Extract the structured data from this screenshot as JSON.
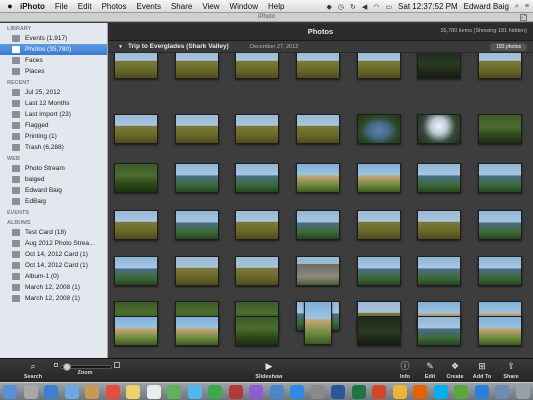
{
  "menubar": {
    "app": "iPhoto",
    "items": [
      "File",
      "Edit",
      "Photos",
      "Events",
      "Share",
      "View",
      "Window",
      "Help"
    ],
    "clock": "Sat 12:37:52 PM",
    "user": "Edward Baig",
    "icons": [
      "apple-icon",
      "dropbox-icon",
      "time-machine-icon",
      "sync-icon",
      "volume-icon",
      "wifi-icon",
      "battery-icon",
      "spotlight-icon",
      "list-icon"
    ]
  },
  "window": {
    "title": "iPhoto"
  },
  "sidebar": {
    "library_heading": "LIBRARY",
    "library": [
      {
        "label": "Events (1,917)",
        "icon": "events-icon"
      },
      {
        "label": "Photos (35,780)",
        "icon": "photos-icon",
        "selected": true
      },
      {
        "label": "Faces",
        "icon": "faces-icon"
      },
      {
        "label": "Places",
        "icon": "places-icon"
      }
    ],
    "recent_heading": "RECENT",
    "recent": [
      {
        "label": "Jul 25, 2012",
        "icon": "event-icon"
      },
      {
        "label": "Last 12 Months",
        "icon": "calendar-icon"
      },
      {
        "label": "Last Import (23)",
        "icon": "import-icon"
      },
      {
        "label": "Flagged",
        "icon": "flag-icon"
      },
      {
        "label": "Printing (1)",
        "icon": "print-icon"
      },
      {
        "label": "Trash (6,288)",
        "icon": "trash-icon"
      }
    ],
    "web_heading": "WEB",
    "web": [
      {
        "label": "Photo Stream",
        "icon": "photo-stream-icon"
      },
      {
        "label": "baiged",
        "icon": "web-album-icon"
      },
      {
        "label": "Edward Baig",
        "icon": "web-album-icon"
      },
      {
        "label": "EdBaig",
        "icon": "web-album-icon"
      }
    ],
    "events_heading": "EVENTS",
    "albums_heading": "ALBUMS",
    "albums": [
      {
        "label": "Test Card (18)",
        "icon": "album-icon"
      },
      {
        "label": "Aug 2012 Photo Strea...",
        "icon": "album-icon"
      },
      {
        "label": "Oct 14, 2012 Card (1)",
        "icon": "album-icon"
      },
      {
        "label": "Oct 14, 2012 Card (1)",
        "icon": "album-icon"
      },
      {
        "label": "Album-1 (0)",
        "icon": "folder-icon"
      },
      {
        "label": "March 12, 2008 (1)",
        "icon": "album-icon"
      },
      {
        "label": "March 12, 2008 (1)",
        "icon": "album-icon"
      }
    ]
  },
  "header": {
    "title": "Photos",
    "count": "35,780 items (Showing 181 hidden)"
  },
  "event": {
    "name": "Trip to Everglades (Shark Valley)",
    "date": "December 27, 2012",
    "count": "183 photos"
  },
  "photos": [
    "marsh",
    "marsh",
    "marsh",
    "marsh",
    "marsh",
    "dark",
    "marsh",
    "marsh",
    "marsh",
    "marsh",
    "marsh",
    "pond",
    "bright",
    "trees",
    "trees",
    "water",
    "water",
    "people",
    "people",
    "water",
    "water",
    "marsh",
    "water",
    "marsh",
    "water",
    "marsh",
    "marsh",
    "water",
    "water",
    "marsh",
    "marsh",
    "sign",
    "water",
    "water",
    "water",
    "trees",
    "trees",
    "trees",
    "water",
    "marsh",
    "people",
    "people",
    "people",
    "people",
    "trees",
    "portrait",
    "dark",
    "water",
    "people"
  ],
  "toolbar": {
    "left": [
      {
        "label": "Search",
        "icon": "search-icon"
      },
      {
        "label": "Zoom",
        "icon": "zoom-slider-icon"
      }
    ],
    "center": {
      "label": "Slideshow",
      "icon": "play-icon"
    },
    "right": [
      {
        "label": "Info",
        "icon": "info-icon"
      },
      {
        "label": "Edit",
        "icon": "edit-icon"
      },
      {
        "label": "Create",
        "icon": "create-icon"
      },
      {
        "label": "Add To",
        "icon": "add-to-icon"
      },
      {
        "label": "Share",
        "icon": "share-icon"
      }
    ]
  },
  "dock": [
    "finder-icon",
    "launchpad-icon",
    "safari-icon",
    "mail-icon",
    "contacts-icon",
    "calendar-icon",
    "notes-icon",
    "reminders-icon",
    "maps-icon",
    "messages-icon",
    "facetime-icon",
    "photo-booth-icon",
    "itunes-icon",
    "iphoto-icon",
    "app-store-icon",
    "system-preferences-icon",
    "word-icon",
    "excel-icon",
    "powerpoint-icon",
    "chrome-icon",
    "firefox-icon",
    "skype-icon",
    "evernote-icon",
    "dropbox-icon",
    "downloads-icon",
    "trash-icon"
  ],
  "colors": {
    "selection": "#3b7bd2",
    "sidebar_bg": "#e3e7ee",
    "content_bg": "#3d3d3d",
    "toolbar_bg": "#2e2e2e"
  }
}
